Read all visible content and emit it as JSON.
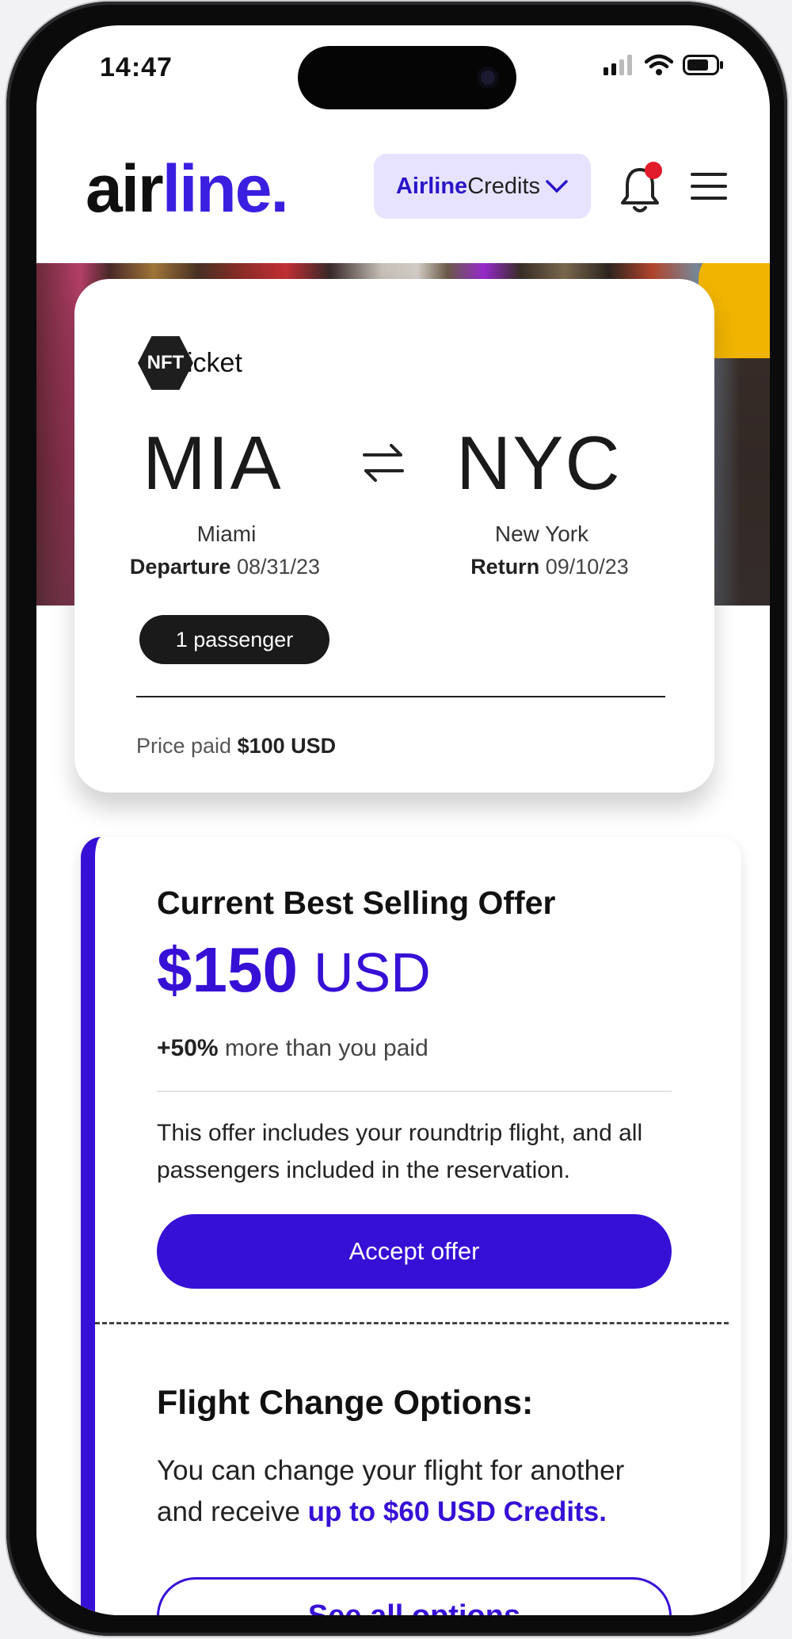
{
  "status_bar": {
    "time": "14:47"
  },
  "header": {
    "logo_prefix": "air",
    "logo_accent": "line.",
    "credits_bold": "Airline",
    "credits_rest": "Credits"
  },
  "ticket": {
    "brand_mark": "NFT",
    "brand_text": "icket",
    "from_code": "MIA",
    "to_code": "NYC",
    "from_city": "Miami",
    "to_city": "New York",
    "departure_label": "Departure",
    "departure_date": "08/31/23",
    "return_label": "Return",
    "return_date": "09/10/23",
    "passengers": "1 passenger",
    "price_label": "Price paid",
    "price_value": "$100 USD"
  },
  "offer": {
    "title": "Current Best Selling Offer",
    "amount": "$150",
    "currency": "USD",
    "pct": "+50%",
    "pct_text": "more than you paid",
    "description": "This offer includes your roundtrip flight, and all passengers included in the reservation.",
    "accept_label": "Accept offer"
  },
  "change": {
    "title": "Flight Change Options:",
    "desc_pre": "You can change your flight for another and receive ",
    "desc_highlight": "up to $60 USD Credits.",
    "options_label": "See all options"
  },
  "colors": {
    "accent": "#3710d6",
    "notification": "#e21b2d"
  },
  "icons": [
    "signal-icon",
    "wifi-icon",
    "battery-icon",
    "chevron-down-icon",
    "bell-icon",
    "menu-icon",
    "swap-arrows-icon"
  ]
}
